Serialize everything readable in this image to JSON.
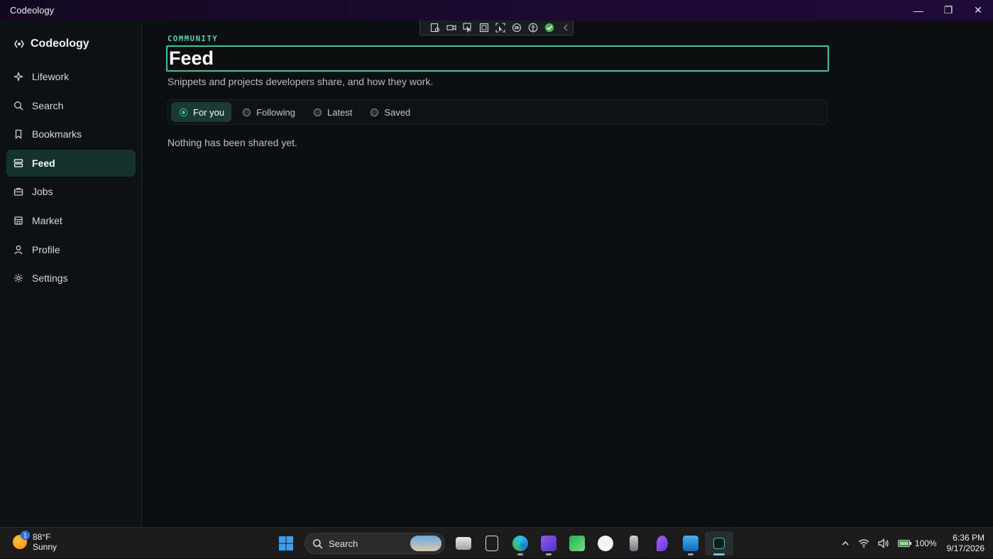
{
  "window": {
    "title": "Codeology",
    "minimize_glyph": "—",
    "maximize_glyph": "❐",
    "close_glyph": "✕"
  },
  "sidebar": {
    "brand": "Codeology",
    "items": [
      {
        "label": "Lifework",
        "icon": "sparkle-icon",
        "active": false
      },
      {
        "label": "Search",
        "icon": "search-icon",
        "active": false
      },
      {
        "label": "Bookmarks",
        "icon": "bookmark-icon",
        "active": false
      },
      {
        "label": "Feed",
        "icon": "feed-icon",
        "active": true
      },
      {
        "label": "Jobs",
        "icon": "briefcase-icon",
        "active": false
      },
      {
        "label": "Market",
        "icon": "store-icon",
        "active": false
      },
      {
        "label": "Profile",
        "icon": "person-icon",
        "active": false
      },
      {
        "label": "Settings",
        "icon": "gear-icon",
        "active": false
      }
    ]
  },
  "main": {
    "eyebrow": "COMMUNITY",
    "title": "Feed",
    "subtitle": "Snippets and projects developers share, and how they work.",
    "tabs": [
      {
        "label": "For you",
        "selected": true
      },
      {
        "label": "Following",
        "selected": false
      },
      {
        "label": "Latest",
        "selected": false
      },
      {
        "label": "Saved",
        "selected": false
      }
    ],
    "empty_message": "Nothing has been shared yet."
  },
  "devbar": {
    "tools": [
      "live-visual-tree-icon",
      "record-icon",
      "select-element-icon",
      "display-layout-adorners-icon",
      "track-focus-icon",
      "hot-reload-icon",
      "accessibility-icon",
      "binding-check-icon",
      "collapse-icon"
    ]
  },
  "taskbar": {
    "weather": {
      "temp": "88°F",
      "condition": "Sunny",
      "badge": "1"
    },
    "search_label": "Search",
    "apps": [
      "file-explorer-icon",
      "epic-games-icon",
      "edge-icon",
      "visual-studio-icon",
      "chart-app-icon",
      "app-installer-icon",
      "usb-device-icon",
      "copilot-icon",
      "photos-icon",
      "codeology-icon"
    ],
    "battery": "100%",
    "time": "6:36 PM",
    "date": "9/17/2026"
  },
  "colors": {
    "accent": "#2cc9a9",
    "active_nav_bg": "#15332e",
    "background": "#0c0e10"
  }
}
